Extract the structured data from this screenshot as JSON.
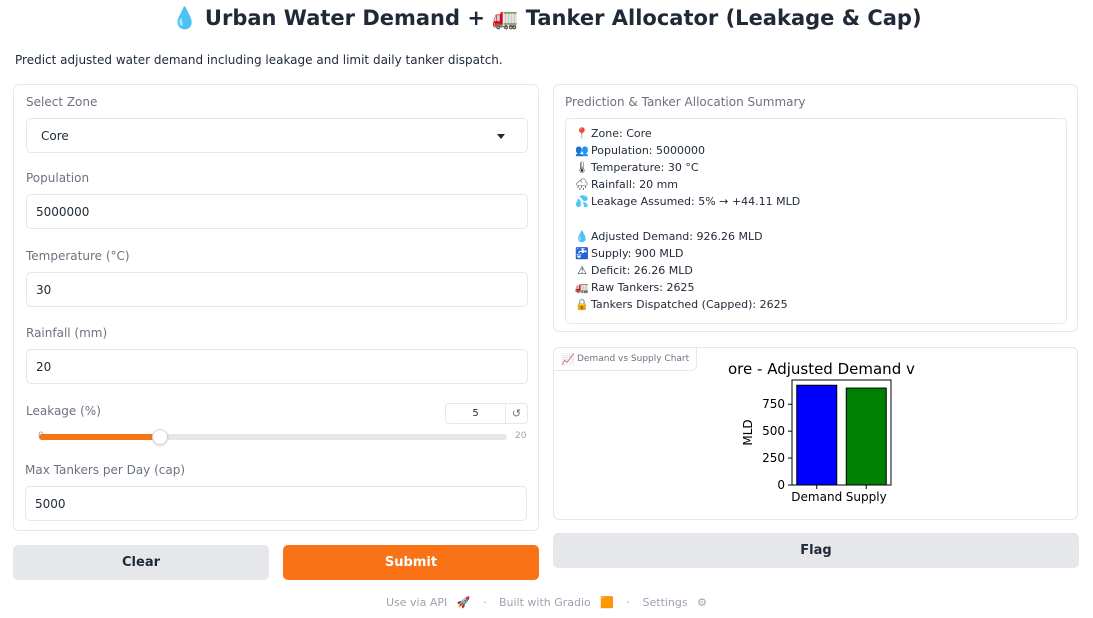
{
  "header": {
    "title": "💧 Urban Water Demand + 🚛 Tanker Allocator (Leakage & Cap)",
    "subtitle": "Predict adjusted water demand including leakage and limit daily tanker dispatch."
  },
  "form": {
    "zone": {
      "label": "Select Zone",
      "value": "Core"
    },
    "population": {
      "label": "Population",
      "value": "5000000"
    },
    "temperature": {
      "label": "Temperature (°C)",
      "value": "30"
    },
    "rainfall": {
      "label": "Rainfall (mm)",
      "value": "20"
    },
    "leakage": {
      "label": "Leakage (%)",
      "value": "5",
      "min": "0",
      "max": "20",
      "fraction": 0.25,
      "reset_icon": "↺"
    },
    "max_tankers": {
      "label": "Max Tankers per Day (cap)",
      "value": "5000"
    }
  },
  "summary": {
    "label": "Prediction & Tanker Allocation Summary",
    "lines": [
      {
        "icon": "📍",
        "text": "Zone: Core"
      },
      {
        "icon": "👥",
        "text": "Population: 5000000"
      },
      {
        "icon": "🌡",
        "text": "Temperature: 30 °C"
      },
      {
        "icon": "🌧",
        "text": "Rainfall: 20 mm"
      },
      {
        "icon": "💦",
        "text": "Leakage Assumed: 5% → +44.11 MLD"
      },
      {
        "icon": "💧",
        "text": "Adjusted Demand: 926.26 MLD"
      },
      {
        "icon": "🚰",
        "text": "Supply: 900 MLD"
      },
      {
        "icon": "⚠",
        "text": "Deficit: 26.26 MLD"
      },
      {
        "icon": "🚛",
        "text": "Raw Tankers: 2625"
      },
      {
        "icon": "🔒",
        "text": "Tankers Dispatched (Capped): 2625"
      }
    ]
  },
  "chart_panel": {
    "tab_label": "Demand vs Supply Chart",
    "tab_icon": "📈"
  },
  "chart_data": {
    "type": "bar",
    "title": "ore - Adjusted Demand v",
    "xlabel": "",
    "ylabel": "MLD",
    "categories": [
      "Demand",
      "Supply"
    ],
    "values": [
      926.26,
      900
    ],
    "colors": [
      "#0000ff",
      "#008000"
    ],
    "ylim": [
      0,
      975
    ],
    "yticks": [
      0,
      250,
      500,
      750
    ]
  },
  "buttons": {
    "clear": "Clear",
    "submit": "Submit",
    "flag": "Flag"
  },
  "footer": {
    "api": "Use via API",
    "api_icon": "🚀",
    "sep1": "·",
    "built": "Built with Gradio",
    "built_icon": "🟧",
    "sep2": "·",
    "settings": "Settings",
    "settings_icon": "⚙"
  }
}
